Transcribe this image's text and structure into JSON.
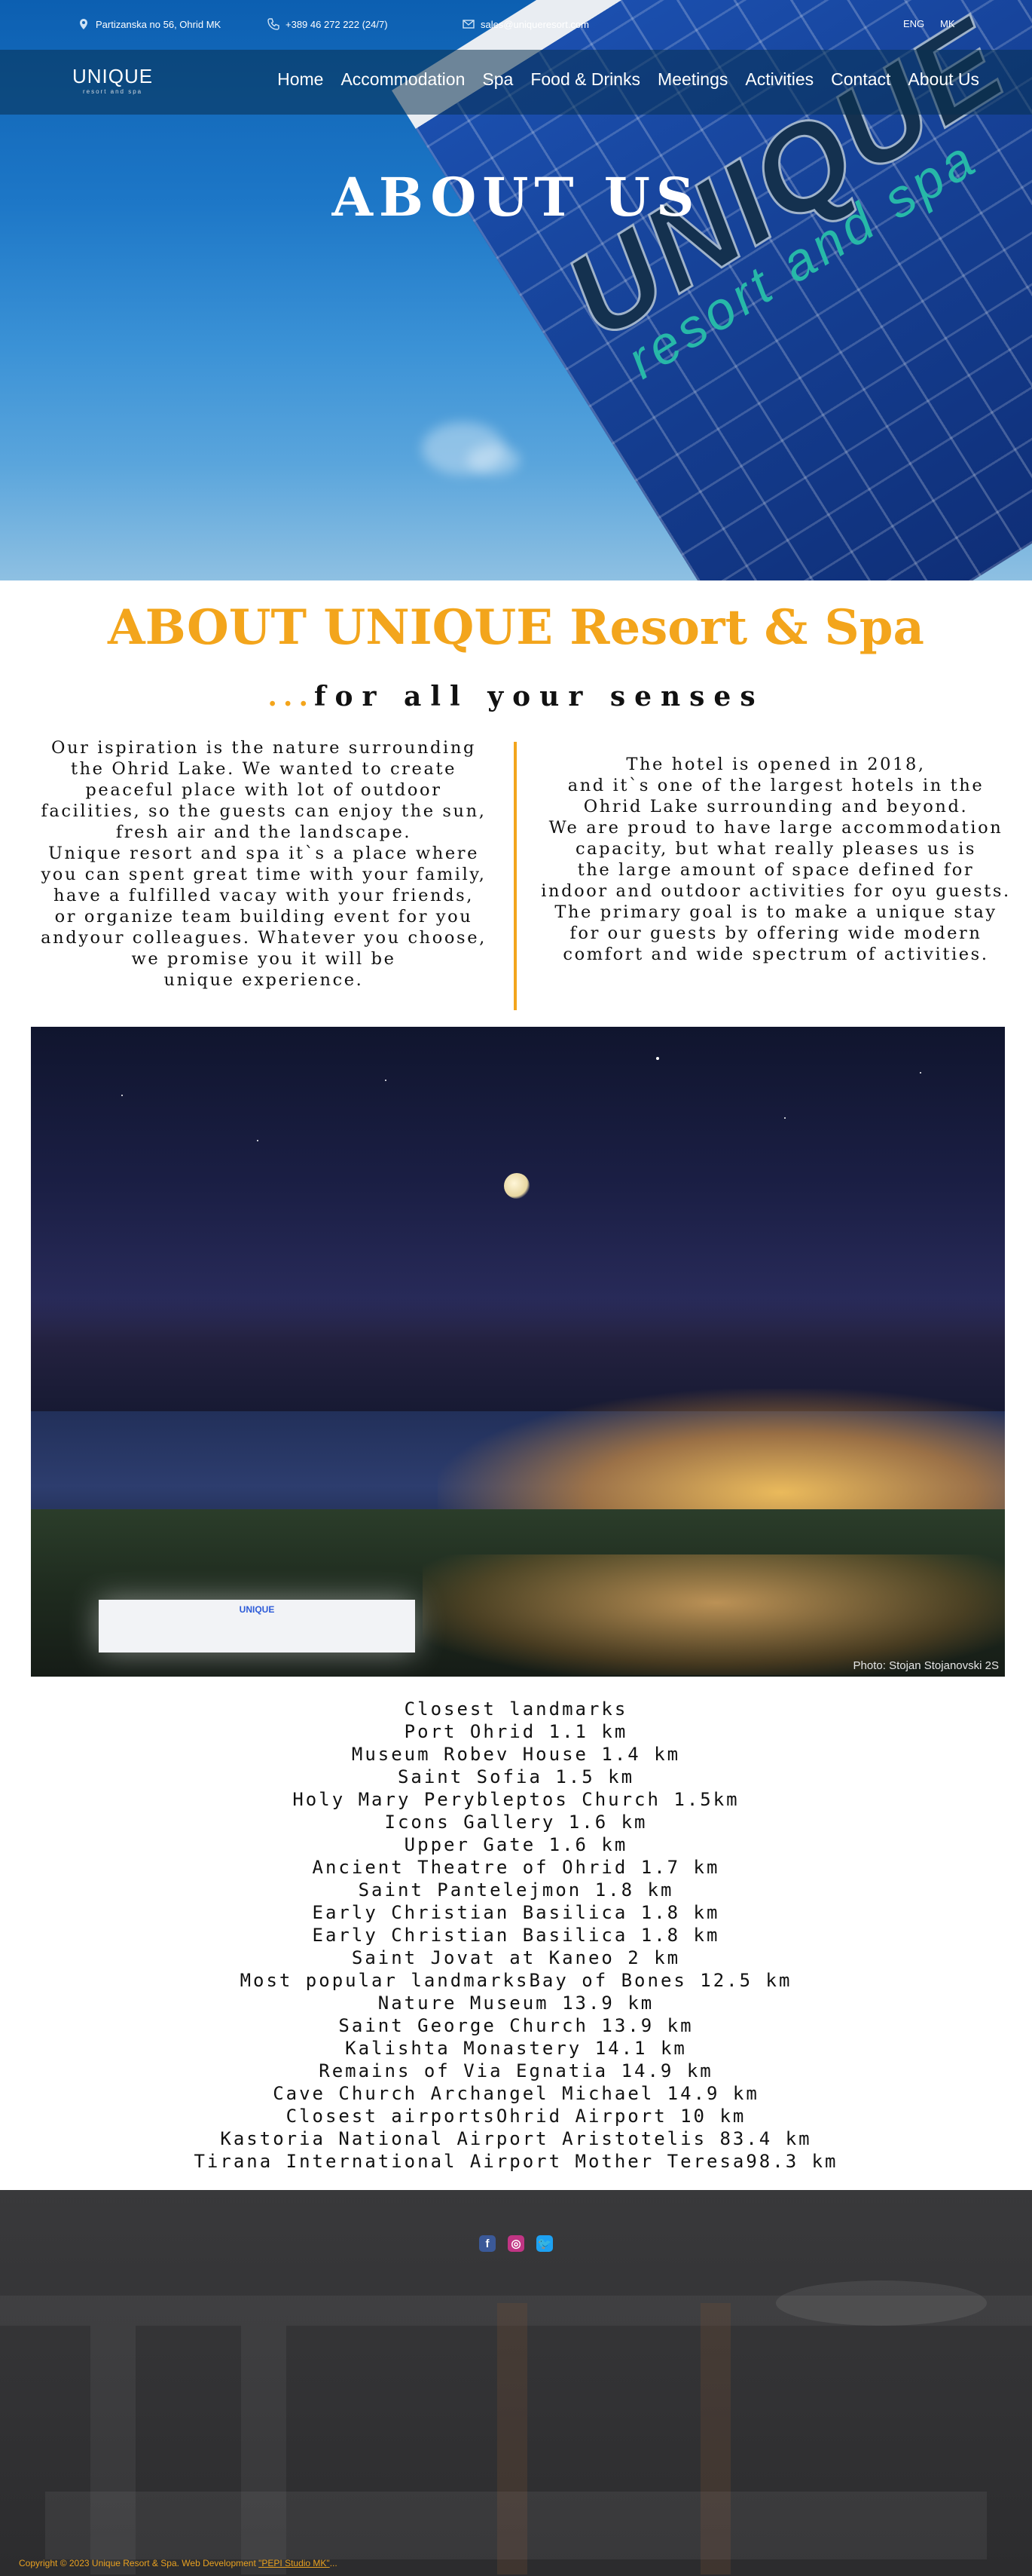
{
  "topbar": {
    "address": "Partizanska no 56, Ohrid MK",
    "phone": "+389 46 272 222 (24/7)",
    "email": "sales@uniqueresort.com",
    "lang_en": "ENG",
    "lang_mk": "MK"
  },
  "logo": {
    "main": "UNIQUE",
    "sub": "resort and spa"
  },
  "nav": [
    "Home",
    "Accommodation",
    "Spa",
    "Food & Drinks",
    "Meetings",
    "Activities",
    "Contact",
    "About Us"
  ],
  "hero": {
    "title": "ABOUT US",
    "sign_main": "UNIQUE",
    "sign_sub": "resort and spa"
  },
  "intro": {
    "heading": "ABOUT  UNIQUE  Resort & Spa",
    "subheading_dots": "...",
    "subheading": "for all your senses",
    "left_lines": [
      "Our ispiration is the nature surrounding",
      "the Ohrid Lake. We wanted to create",
      "peaceful place with lot of outdoor",
      "facilities, so the guests can enjoy the sun,",
      "fresh air and the landscape.",
      "Unique resort and spa it`s a place where",
      "you can spent great time with your family,",
      "have a fulfilled vacay with your friends,",
      "or organize team building event for you",
      "andyour colleagues. Whatever you choose,",
      "we promise you it will be",
      "unique experience."
    ],
    "right_lines": [
      "The hotel is opened in 2018,",
      "and it`s one of the largest hotels in the",
      "Ohrid Lake surrounding and beyond.",
      "We are proud to have large accommodation",
      "capacity, but what really pleases us is",
      "the large amount of space defined for",
      "indoor and outdoor activities for oyu guests.",
      "The primary goal is to make a unique stay",
      "for our guests by offering wide modern",
      "comfort and wide spectrum of activities."
    ]
  },
  "photo": {
    "credit": "Photo: Stojan Stojanovski 2S",
    "hotel_sign": "UNIQUE"
  },
  "landmarks": [
    "Closest landmarks",
    "Port Ohrid 1.1 km",
    "Museum Robev House 1.4 km",
    "Saint Sofia 1.5 km",
    "Holy Mary Perybleptos Church 1.5km",
    "Icons Gallery 1.6 km",
    "Upper Gate 1.6 km",
    "Ancient Theatre of Ohrid 1.7 km",
    "Saint Pantelejmon 1.8 km",
    "Early Christian Basilica 1.8 km",
    "Early Christian Basilica 1.8 km",
    "Saint Jovat at Kaneo 2 km",
    "Most popular landmarksBay of Bones 12.5 km",
    "Nature Museum 13.9 km",
    "Saint George Church 13.9 km",
    "Kalishta Monastery 14.1 km",
    "Remains of Via Egnatia 14.9 km",
    "Cave Church Archangel Michael 14.9 km",
    "Closest airportsOhrid Airport 10 km",
    "Kastoria National Airport Aristotelis 83.4 km",
    "Tirana International Airport Mother Teresa98.3 km"
  ],
  "footer": {
    "social": [
      {
        "icon": "facebook-icon",
        "glyph": "f",
        "color": "#3b5998"
      },
      {
        "icon": "instagram-icon",
        "glyph": "◎",
        "color": "#c13584"
      },
      {
        "icon": "twitter-icon",
        "glyph": "🐦",
        "color": "#1da1f2"
      }
    ],
    "copyright_prefix": "Copyright © 2023 Unique Resort & Spa. Web Development ",
    "copyright_link": "\"PEPI Studio MK\"",
    "copyright_suffix": "..."
  },
  "colors": {
    "accent": "#f3a51c",
    "hero_blue": "#1d77c7",
    "nav_overlay": "#083050"
  }
}
